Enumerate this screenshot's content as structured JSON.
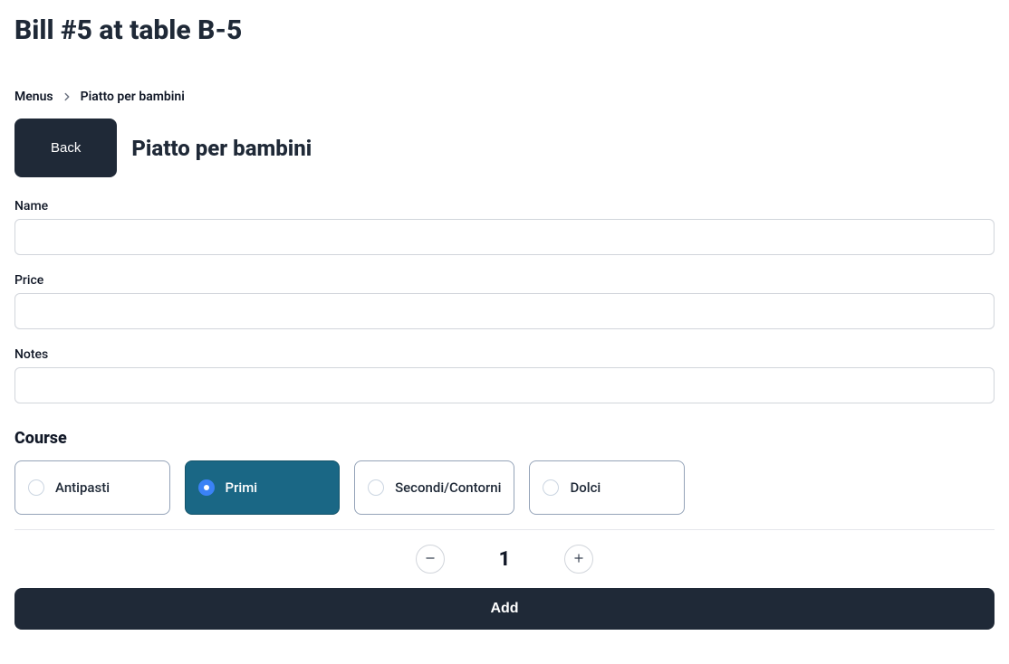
{
  "header": {
    "title": "Bill #5 at table B-5"
  },
  "breadcrumb": {
    "root": "Menus",
    "current": "Piatto per bambini"
  },
  "back_label": "Back",
  "section_title": "Piatto per bambini",
  "form": {
    "name_label": "Name",
    "name_value": "",
    "price_label": "Price",
    "price_value": "",
    "notes_label": "Notes",
    "notes_value": ""
  },
  "course": {
    "heading": "Course",
    "options": [
      {
        "label": "Antipasti",
        "selected": false
      },
      {
        "label": "Primi",
        "selected": true
      },
      {
        "label": "Secondi/Contorni",
        "selected": false
      },
      {
        "label": "Dolci",
        "selected": false
      }
    ]
  },
  "quantity": {
    "value": "1"
  },
  "add_label": "Add"
}
